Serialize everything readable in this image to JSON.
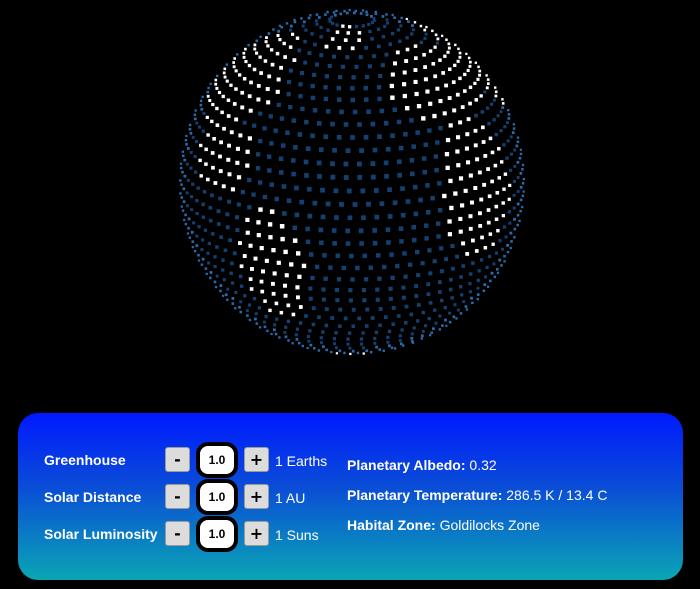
{
  "planet": {
    "colors": {
      "ocean_dot": "#13406e",
      "ocean_dot_bright": "#2a6aa8",
      "land_dot": "#ffffff",
      "background": "#000000"
    }
  },
  "controls": [
    {
      "id": "greenhouse",
      "label": "Greenhouse",
      "minus": "-",
      "plus": "+",
      "value": "1.0",
      "unit": "1 Earths"
    },
    {
      "id": "solar-distance",
      "label": "Solar Distance",
      "minus": "-",
      "plus": "+",
      "value": "1.0",
      "unit": "1 AU"
    },
    {
      "id": "solar-luminosity",
      "label": "Solar Luminosity",
      "minus": "-",
      "plus": "+",
      "value": "1.0",
      "unit": "1 Suns"
    }
  ],
  "stats": {
    "albedo": {
      "label": "Planetary Albedo:",
      "value": "0.32"
    },
    "temperature": {
      "label": "Planetary Temperature:",
      "value": "286.5 K / 13.4 C"
    },
    "habitable": {
      "label": "Habital Zone:",
      "value": "Goldilocks Zone"
    }
  },
  "panel": {
    "gradient_top": "#0019ff",
    "gradient_bottom": "#0aa6b4"
  }
}
